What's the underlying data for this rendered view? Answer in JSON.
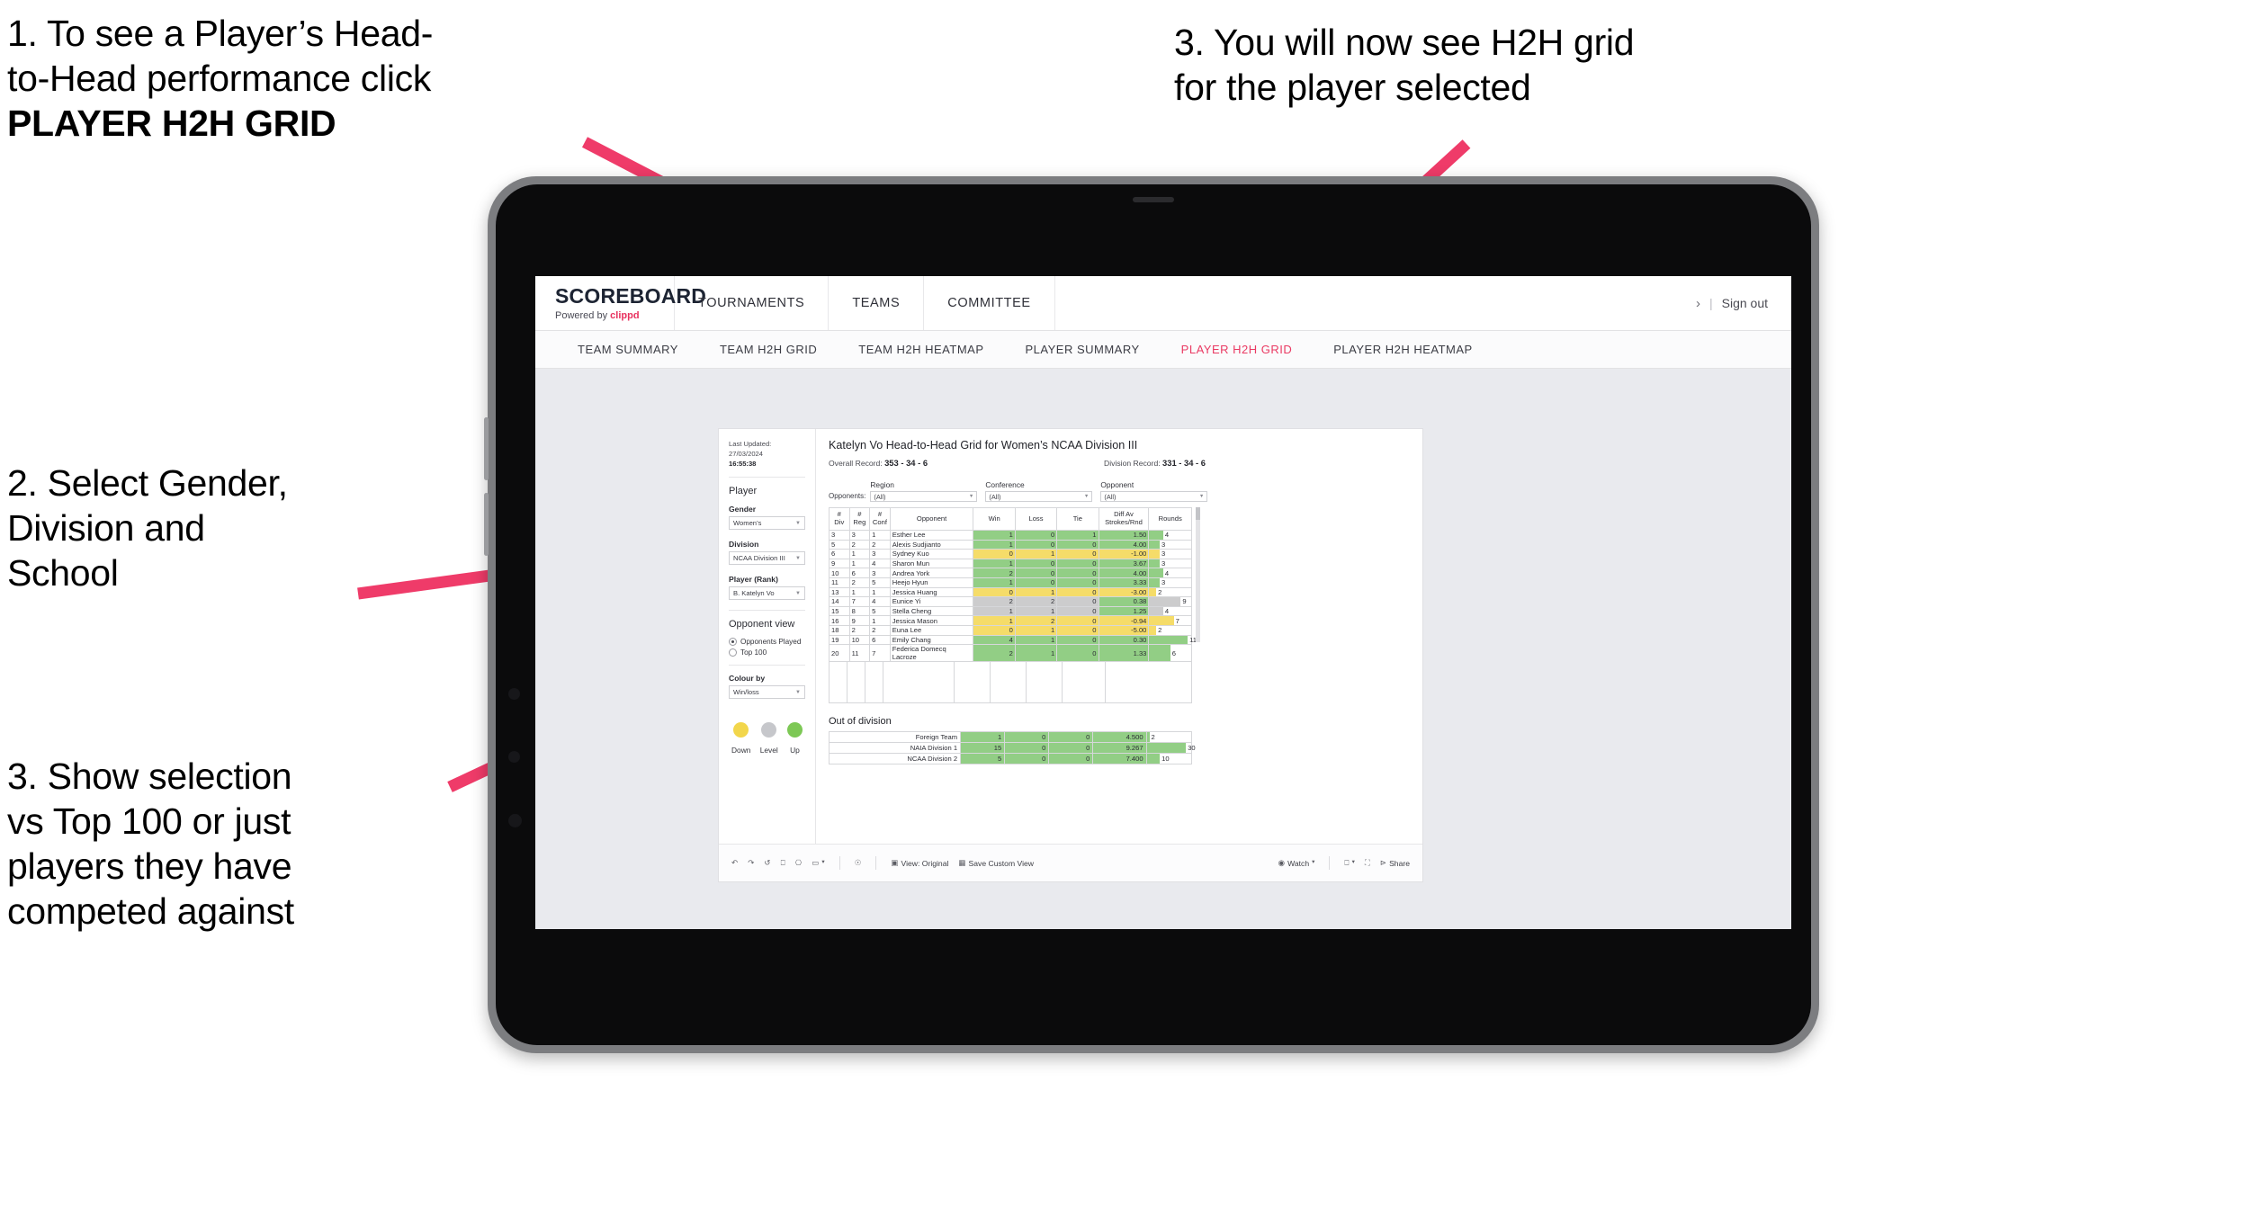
{
  "annotations": [
    {
      "id": "a1",
      "line1": "1. To see a Player’s Head-",
      "line2": "to-Head performance click",
      "line3": "PLAYER H2H GRID"
    },
    {
      "id": "a2",
      "line1": "2. Select Gender,",
      "line2": "Division and",
      "line3": "School"
    },
    {
      "id": "a3",
      "line1": "3. Show selection",
      "line2": "vs Top 100 or just",
      "line3": "players they have",
      "line4": "competed against"
    },
    {
      "id": "a4",
      "line1": "3. You will now see H2H grid",
      "line2": "for the player selected"
    }
  ],
  "colors": {
    "accent": "#ea3a63",
    "arrow": "#ef3b69",
    "win_green": "#92ce85",
    "loss_yellow": "#f5dc69",
    "tie_grey": "#cccccd"
  },
  "app": {
    "brand": {
      "name": "SCOREBOARD",
      "powered_prefix": "Powered by",
      "powered_by": "clippd"
    },
    "topnav": [
      "TOURNAMENTS",
      "TEAMS",
      "COMMITTEE"
    ],
    "header_right": {
      "chevron": "›",
      "separator": "|",
      "signout": "Sign out"
    },
    "subnav": {
      "tabs": [
        "TEAM SUMMARY",
        "TEAM H2H GRID",
        "TEAM H2H HEATMAP",
        "PLAYER SUMMARY",
        "PLAYER H2H GRID",
        "PLAYER H2H HEATMAP"
      ],
      "active": "PLAYER H2H GRID"
    }
  },
  "sidebar": {
    "last_updated_label": "Last Updated: 27/03/2024",
    "last_updated_time": "16:55:38",
    "player_heading": "Player",
    "filters": [
      {
        "label": "Gender",
        "value": "Women’s"
      },
      {
        "label": "Division",
        "value": "NCAA Division III"
      },
      {
        "label": "Player (Rank)",
        "value": "B. Katelyn Vo"
      }
    ],
    "opponent_view": {
      "heading": "Opponent view",
      "options": [
        {
          "label": "Opponents Played",
          "selected": true
        },
        {
          "label": "Top 100",
          "selected": false
        }
      ]
    },
    "colour_by": {
      "label": "Colour by",
      "value": "Win/loss"
    },
    "legend": [
      {
        "label": "Down",
        "color": "#f2d64b"
      },
      {
        "label": "Level",
        "color": "#c6c7cb"
      },
      {
        "label": "Up",
        "color": "#7dc855"
      }
    ]
  },
  "main": {
    "title": "Katelyn Vo Head-to-Head Grid for Women’s NCAA Division III",
    "overall_record_label": "Overall Record:",
    "overall_record": "353 -  34 - 6",
    "division_record_label": "Division Record:",
    "division_record": "331 -  34 - 6",
    "opponents_label": "Opponents:",
    "opponent_filters": [
      {
        "label": "Region",
        "value": "(All)"
      },
      {
        "label": "Conference",
        "value": "(All)"
      },
      {
        "label": "Opponent",
        "value": "(All)"
      }
    ],
    "out_of_division_heading": "Out of division"
  },
  "chart_data": {
    "type": "table",
    "title": "Katelyn Vo Head-to-Head Grid for Women’s NCAA Division III",
    "columns": [
      "# Div",
      "# Reg",
      "# Conf",
      "Opponent",
      "Win",
      "Loss",
      "Tie",
      "Diff Av Strokes/Rnd",
      "Rounds"
    ],
    "column_headers_multiline": [
      [
        "#",
        "Div"
      ],
      [
        "#",
        "Reg"
      ],
      [
        "#",
        "Conf"
      ],
      [
        "Opponent"
      ],
      [
        "Win"
      ],
      [
        "Loss"
      ],
      [
        "Tie"
      ],
      [
        "Diff Av",
        "Strokes/Rnd"
      ],
      [
        "Rounds"
      ]
    ],
    "rounds_max": 12,
    "rows": [
      {
        "div": "3",
        "reg": "3",
        "conf": "1",
        "opponent": "Esther Lee",
        "win": "1",
        "loss": "0",
        "tie": "1",
        "diff": "1.50",
        "rounds": "4",
        "state": "up"
      },
      {
        "div": "5",
        "reg": "2",
        "conf": "2",
        "opponent": "Alexis Sudjianto",
        "win": "1",
        "loss": "0",
        "tie": "0",
        "diff": "4.00",
        "rounds": "3",
        "state": "up"
      },
      {
        "div": "6",
        "reg": "1",
        "conf": "3",
        "opponent": "Sydney Kuo",
        "win": "0",
        "loss": "1",
        "tie": "0",
        "diff": "-1.00",
        "rounds": "3",
        "state": "down"
      },
      {
        "div": "9",
        "reg": "1",
        "conf": "4",
        "opponent": "Sharon Mun",
        "win": "1",
        "loss": "0",
        "tie": "0",
        "diff": "3.67",
        "rounds": "3",
        "state": "up"
      },
      {
        "div": "10",
        "reg": "6",
        "conf": "3",
        "opponent": "Andrea York",
        "win": "2",
        "loss": "0",
        "tie": "0",
        "diff": "4.00",
        "rounds": "4",
        "state": "up"
      },
      {
        "div": "11",
        "reg": "2",
        "conf": "5",
        "opponent": "Heejo Hyun",
        "win": "1",
        "loss": "0",
        "tie": "0",
        "diff": "3.33",
        "rounds": "3",
        "state": "up"
      },
      {
        "div": "13",
        "reg": "1",
        "conf": "1",
        "opponent": "Jessica Huang",
        "win": "0",
        "loss": "1",
        "tie": "0",
        "diff": "-3.00",
        "rounds": "2",
        "state": "down"
      },
      {
        "div": "14",
        "reg": "7",
        "conf": "4",
        "opponent": "Eunice Yi",
        "win": "2",
        "loss": "2",
        "tie": "0",
        "diff": "0.38",
        "rounds": "9",
        "state": "level",
        "diff_state": "up"
      },
      {
        "div": "15",
        "reg": "8",
        "conf": "5",
        "opponent": "Stella Cheng",
        "win": "1",
        "loss": "1",
        "tie": "0",
        "diff": "1.25",
        "rounds": "4",
        "state": "level",
        "diff_state": "up"
      },
      {
        "div": "16",
        "reg": "9",
        "conf": "1",
        "opponent": "Jessica Mason",
        "win": "1",
        "loss": "2",
        "tie": "0",
        "diff": "-0.94",
        "rounds": "7",
        "state": "down"
      },
      {
        "div": "18",
        "reg": "2",
        "conf": "2",
        "opponent": "Euna Lee",
        "win": "0",
        "loss": "1",
        "tie": "0",
        "diff": "-5.00",
        "rounds": "2",
        "state": "down"
      },
      {
        "div": "19",
        "reg": "10",
        "conf": "6",
        "opponent": "Emily Chang",
        "win": "4",
        "loss": "1",
        "tie": "0",
        "diff": "0.30",
        "rounds": "11",
        "state": "up"
      },
      {
        "div": "20",
        "reg": "11",
        "conf": "7",
        "opponent": "Federica Domecq Lacroze",
        "win": "2",
        "loss": "1",
        "tie": "0",
        "diff": "1.33",
        "rounds": "6",
        "state": "up"
      }
    ],
    "out_of_division": {
      "rows": [
        {
          "name": "Foreign Team",
          "win": "1",
          "loss": "0",
          "tie": "0",
          "diff": "4.500",
          "rounds": "2",
          "state": "up"
        },
        {
          "name": "NAIA Division 1",
          "win": "15",
          "loss": "0",
          "tie": "0",
          "diff": "9.267",
          "rounds": "30",
          "state": "up"
        },
        {
          "name": "NCAA Division 2",
          "win": "5",
          "loss": "0",
          "tie": "0",
          "diff": "7.400",
          "rounds": "10",
          "state": "up"
        }
      ],
      "rounds_max": 34
    }
  },
  "viz_toolbar": {
    "undo": "undo-icon",
    "redo": "redo-icon",
    "revert": "revert-icon",
    "refresh": "refresh-icon",
    "pause": "pause-icon",
    "region": "region-icon",
    "region_caret": "▾",
    "help": "help-icon",
    "view_label": "View: Original",
    "save_label": "Save Custom View",
    "watch_label": "Watch",
    "watch_caret": "▾",
    "download_caret": "▾",
    "share_label": "Share"
  }
}
